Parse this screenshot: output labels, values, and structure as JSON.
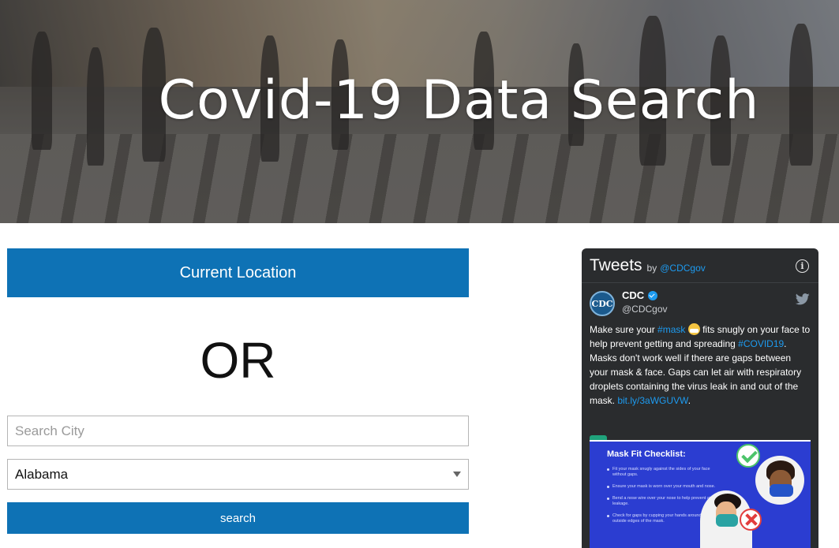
{
  "hero": {
    "title": "Covid-19 Data Search"
  },
  "location_button": {
    "label": "Current Location"
  },
  "divider": {
    "text": "OR"
  },
  "city_search": {
    "placeholder": "Search City",
    "value": ""
  },
  "state_select": {
    "selected": "Alabama"
  },
  "search_button": {
    "label": "search"
  },
  "colors": {
    "accent": "#0e72b5",
    "widget_bg": "#2a2c2e",
    "link": "#1d9bf0"
  },
  "tweets_widget": {
    "title": "Tweets",
    "by": "by",
    "by_handle": "@CDCgov",
    "tweet": {
      "author_name": "CDC",
      "author_handle": "@CDCgov",
      "avatar_text": "CDC",
      "text_1": "Make sure your ",
      "hashtag_mask": "#mask",
      "text_2": " fits snugly on your face to help prevent getting and spreading ",
      "hashtag_covid": "#COVID19",
      "text_3": ". Masks don't work well if there are gaps between your mask & face. Gaps can let air with respiratory droplets containing the virus leak in and out of the mask. ",
      "link": "bit.ly/3aWGUVW",
      "text_4": ".",
      "media": {
        "title": "Mask Fit Checklist:",
        "items": [
          "Fit your mask snugly against the sides of your face without gaps.",
          "Ensure your mask is worn over your mouth and nose.",
          "Bend a nose wire over your nose to help prevent air leakage.",
          "Check for gaps by cupping your hands around the outside edges of the mask."
        ]
      }
    }
  }
}
